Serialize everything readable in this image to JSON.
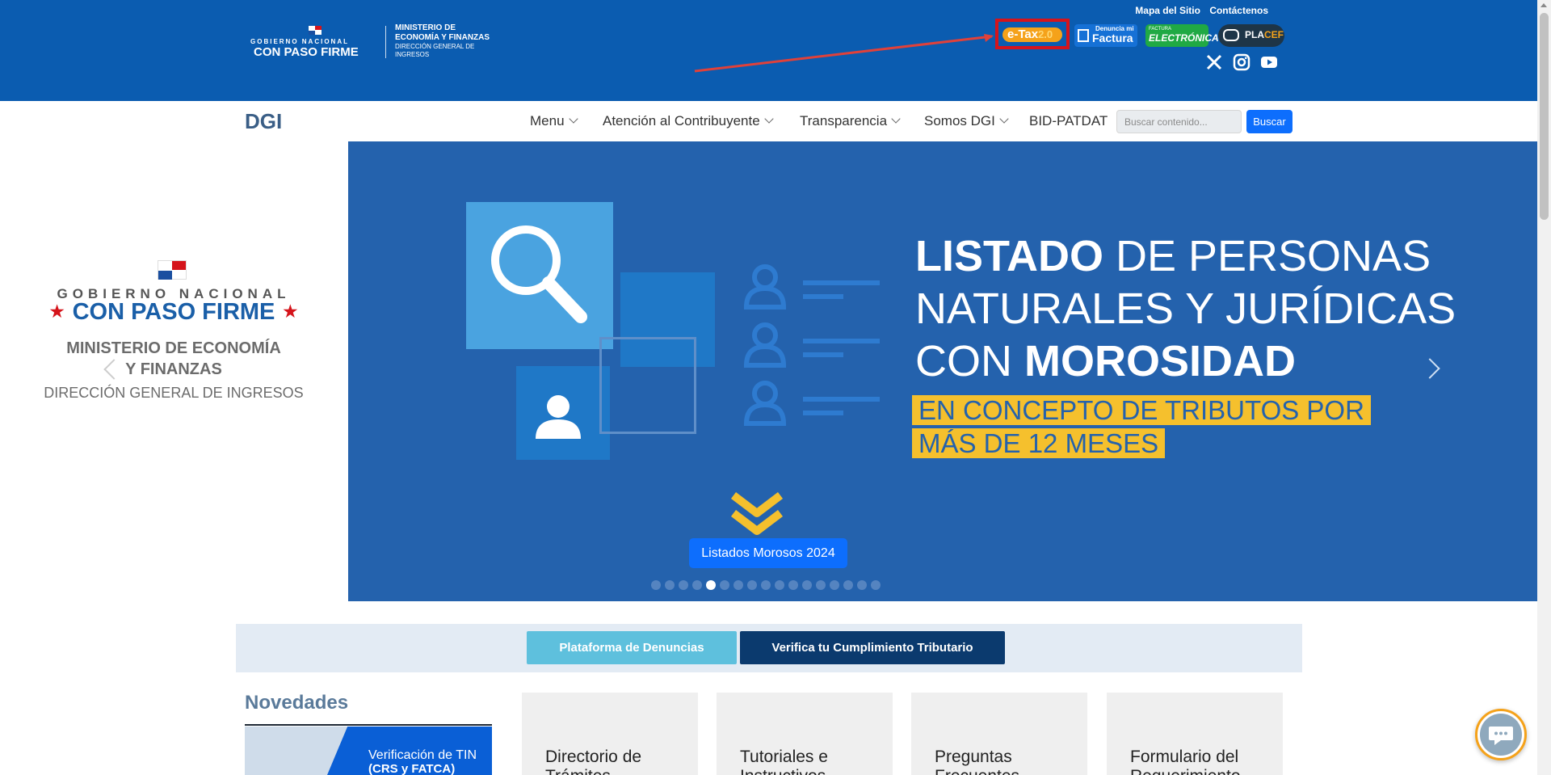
{
  "header": {
    "logo": {
      "line1": "GOBIERNO NACIONAL",
      "line2": "CON PASO FIRME",
      "ministry_line1": "MINISTERIO DE",
      "ministry_line2": "ECONOMÍA Y FINANZAS",
      "ministry_line3": "DIRECCIÓN GENERAL DE",
      "ministry_line4": "INGRESOS"
    },
    "links": {
      "sitemap": "Mapa del Sitio",
      "contact": "Contáctenos"
    },
    "partners": {
      "etax": {
        "label": "e-Tax",
        "suffix": "2.0"
      },
      "denuncia": {
        "small": "Denuncia mi",
        "big": "Factura"
      },
      "factura_electronica": {
        "small": "FACTURA",
        "big": "ELECTRÓNICA"
      },
      "placef": {
        "label_a": "PLA",
        "label_b": "CEF"
      }
    },
    "social_icons": [
      "x-icon",
      "instagram-icon",
      "youtube-icon"
    ]
  },
  "navbar": {
    "brand": "DGI",
    "items": [
      {
        "label": "Menu",
        "dropdown": true
      },
      {
        "label": "Atención al Contribuyente",
        "dropdown": true
      },
      {
        "label": "Transparencia",
        "dropdown": true
      },
      {
        "label": "Somos DGI",
        "dropdown": true
      },
      {
        "label": "BID-PATDAT",
        "dropdown": false
      }
    ],
    "search": {
      "placeholder": "Buscar contenido...",
      "button": "Buscar"
    }
  },
  "side_logo": {
    "line1": "GOBIERNO NACIONAL",
    "line2": "CON PASO FIRME",
    "ministry_line1": "MINISTERIO DE ECONOMÍA",
    "ministry_line2": "Y FINANZAS",
    "direction": "DIRECCIÓN GENERAL DE INGRESOS"
  },
  "hero": {
    "title_line1_a": "LISTADO",
    "title_line1_b": " DE PERSONAS",
    "title_line2": "NATURALES Y JURÍDICAS",
    "title_line3_a": "CON ",
    "title_line3_b": "MOROSIDAD",
    "subtitle_line1": "EN CONCEPTO DE TRIBUTOS POR",
    "subtitle_line2": "MÁS DE 12 MESES",
    "button": "Listados Morosos 2024",
    "slide_count": 17,
    "active_slide": 5
  },
  "actions": {
    "denuncias": "Plataforma de Denuncias",
    "cumplimiento": "Verifica tu Cumplimiento Tributario"
  },
  "novedades": {
    "title": "Novedades",
    "image_text_line1": "Verificación de TIN",
    "image_text_line2": "(CRS y FATCA)"
  },
  "cards": [
    {
      "label": "Directorio de Trámites"
    },
    {
      "label": "Tutoriales e Instructivos"
    },
    {
      "label": "Preguntas Frecuentes"
    },
    {
      "label": "Formulario del Requerimiento"
    }
  ],
  "colors": {
    "header_blue": "#0b5cb0",
    "hero_blue": "#2462ad",
    "highlight_yellow": "#f5c02d",
    "primary_button": "#0d6efd",
    "dark_navy": "#0b3a6e",
    "highlight_red": "#d5141b"
  }
}
